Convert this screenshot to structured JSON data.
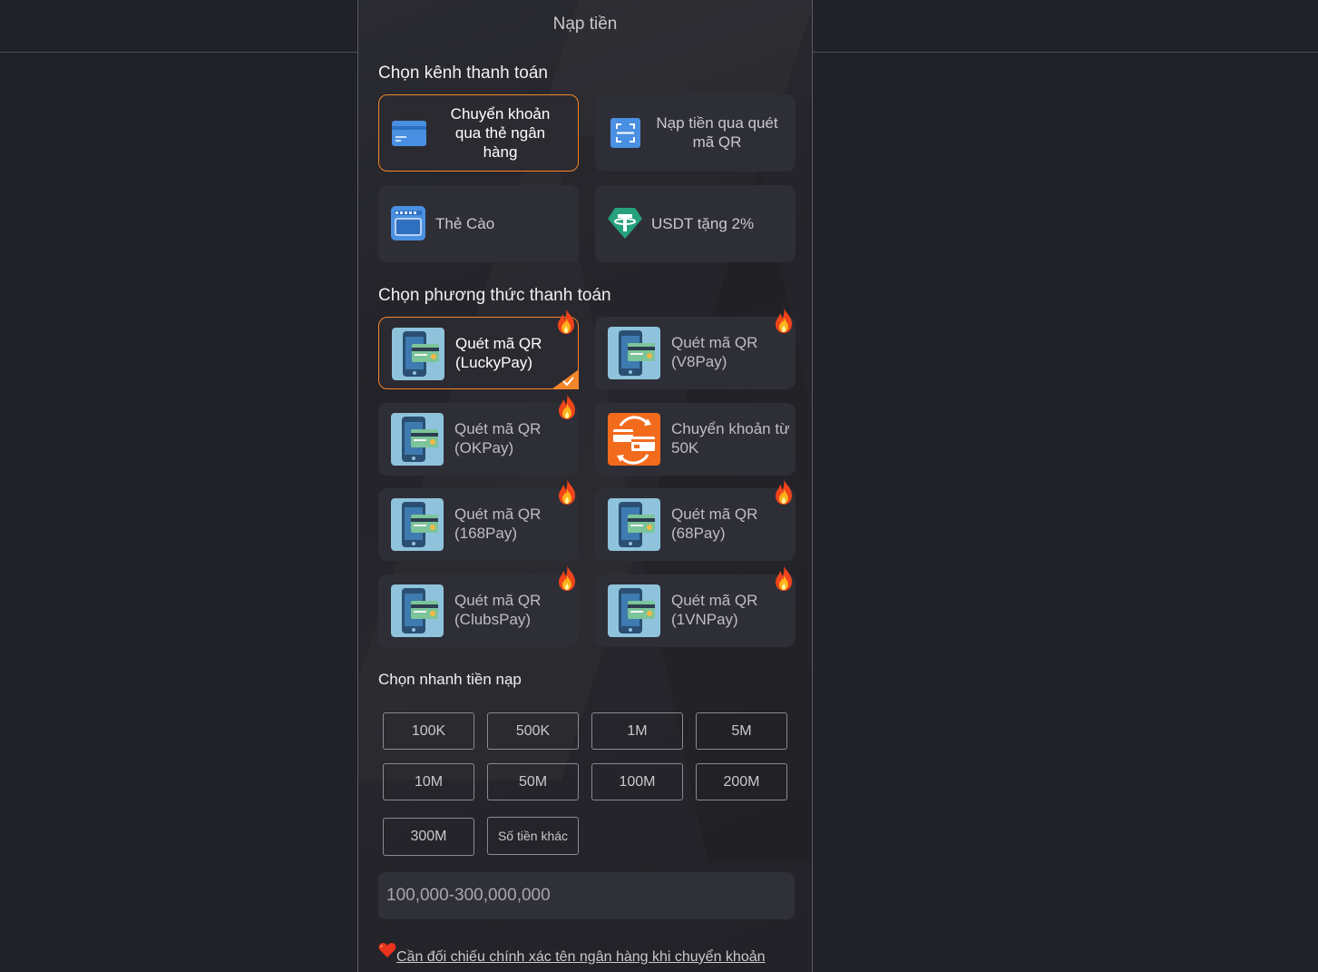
{
  "header": {
    "title": "Nạp tiền"
  },
  "channels": {
    "title": "Chọn kênh thanh toán",
    "items": [
      {
        "label": "Chuyển khoản qua thẻ ngân hàng",
        "icon": "bank-card-icon",
        "selected": true
      },
      {
        "label": "Nạp tiền qua quét mã QR",
        "icon": "qr-scan-icon",
        "selected": false
      },
      {
        "label": "Thẻ Cào",
        "icon": "scratch-card-icon",
        "selected": false
      },
      {
        "label": "USDT tặng 2%",
        "icon": "tether-icon",
        "selected": false
      }
    ]
  },
  "methods": {
    "title": "Chọn phương thức thanh toán",
    "items": [
      {
        "label": "Quét mã QR\n(LuckyPay)",
        "icon": "phone-card-icon",
        "hot": true,
        "selected": true
      },
      {
        "label": "Quét mã QR\n(V8Pay)",
        "icon": "phone-card-icon",
        "hot": true,
        "selected": false
      },
      {
        "label": "Quét mã QR\n(OKPay)",
        "icon": "phone-card-icon",
        "hot": true,
        "selected": false
      },
      {
        "label": "Chuyển khoản từ\n50K",
        "icon": "transfer-icon",
        "hot": false,
        "selected": false
      },
      {
        "label": "Quét mã QR\n(168Pay)",
        "icon": "phone-card-icon",
        "hot": true,
        "selected": false
      },
      {
        "label": "Quét mã QR\n(68Pay)",
        "icon": "phone-card-icon",
        "hot": true,
        "selected": false
      },
      {
        "label": "Quét mã QR\n(ClubsPay)",
        "icon": "phone-card-icon",
        "hot": true,
        "selected": false
      },
      {
        "label": "Quét mã QR\n(1VNPay)",
        "icon": "phone-card-icon",
        "hot": true,
        "selected": false
      }
    ]
  },
  "quick": {
    "title": "Chọn nhanh tiền nạp",
    "amounts": [
      "100K",
      "500K",
      "1M",
      "5M",
      "10M",
      "50M",
      "100M",
      "200M",
      "300M",
      "Số tiền khác"
    ]
  },
  "amount_input": {
    "placeholder": "100,000-300,000,000"
  },
  "note": {
    "text": "Cần đối chiếu chính xác tên ngân hàng khi chuyển khoản",
    "icon": "heart-icon"
  },
  "colors": {
    "accent": "#f2852a",
    "panel": "#2e2e37",
    "background": "#212129"
  }
}
